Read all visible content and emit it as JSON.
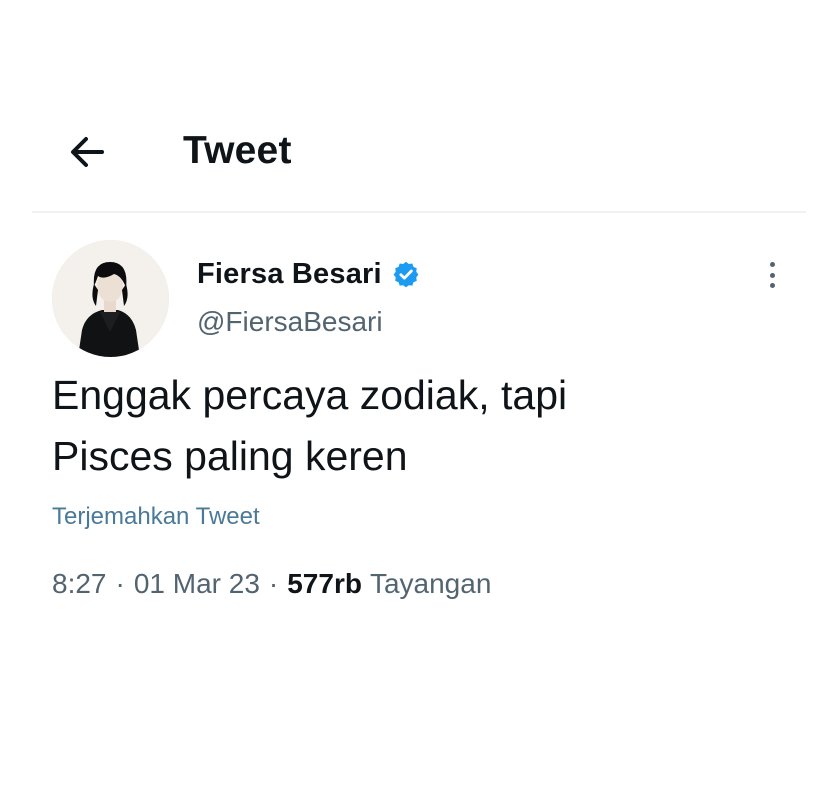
{
  "header": {
    "back_icon": "arrow-left-icon",
    "title": "Tweet"
  },
  "tweet": {
    "author": {
      "display_name": "Fiersa Besari",
      "handle": "@FiersaBesari",
      "verified": true,
      "verified_icon": "verified-badge-icon",
      "verified_color": "#1d9bf0"
    },
    "more_icon": "more-vertical-icon",
    "text": "Enggak percaya zodiak, tapi\nPisces paling keren",
    "translate_label": "Terjemahkan Tweet",
    "time": "8:27",
    "separator": "·",
    "date": "01 Mar 23",
    "views_count": "577rb",
    "views_label": "Tayangan"
  },
  "colors": {
    "text_primary": "#0f1419",
    "text_secondary": "#536471",
    "link": "#4a7a9a",
    "divider": "#eff1f3"
  }
}
